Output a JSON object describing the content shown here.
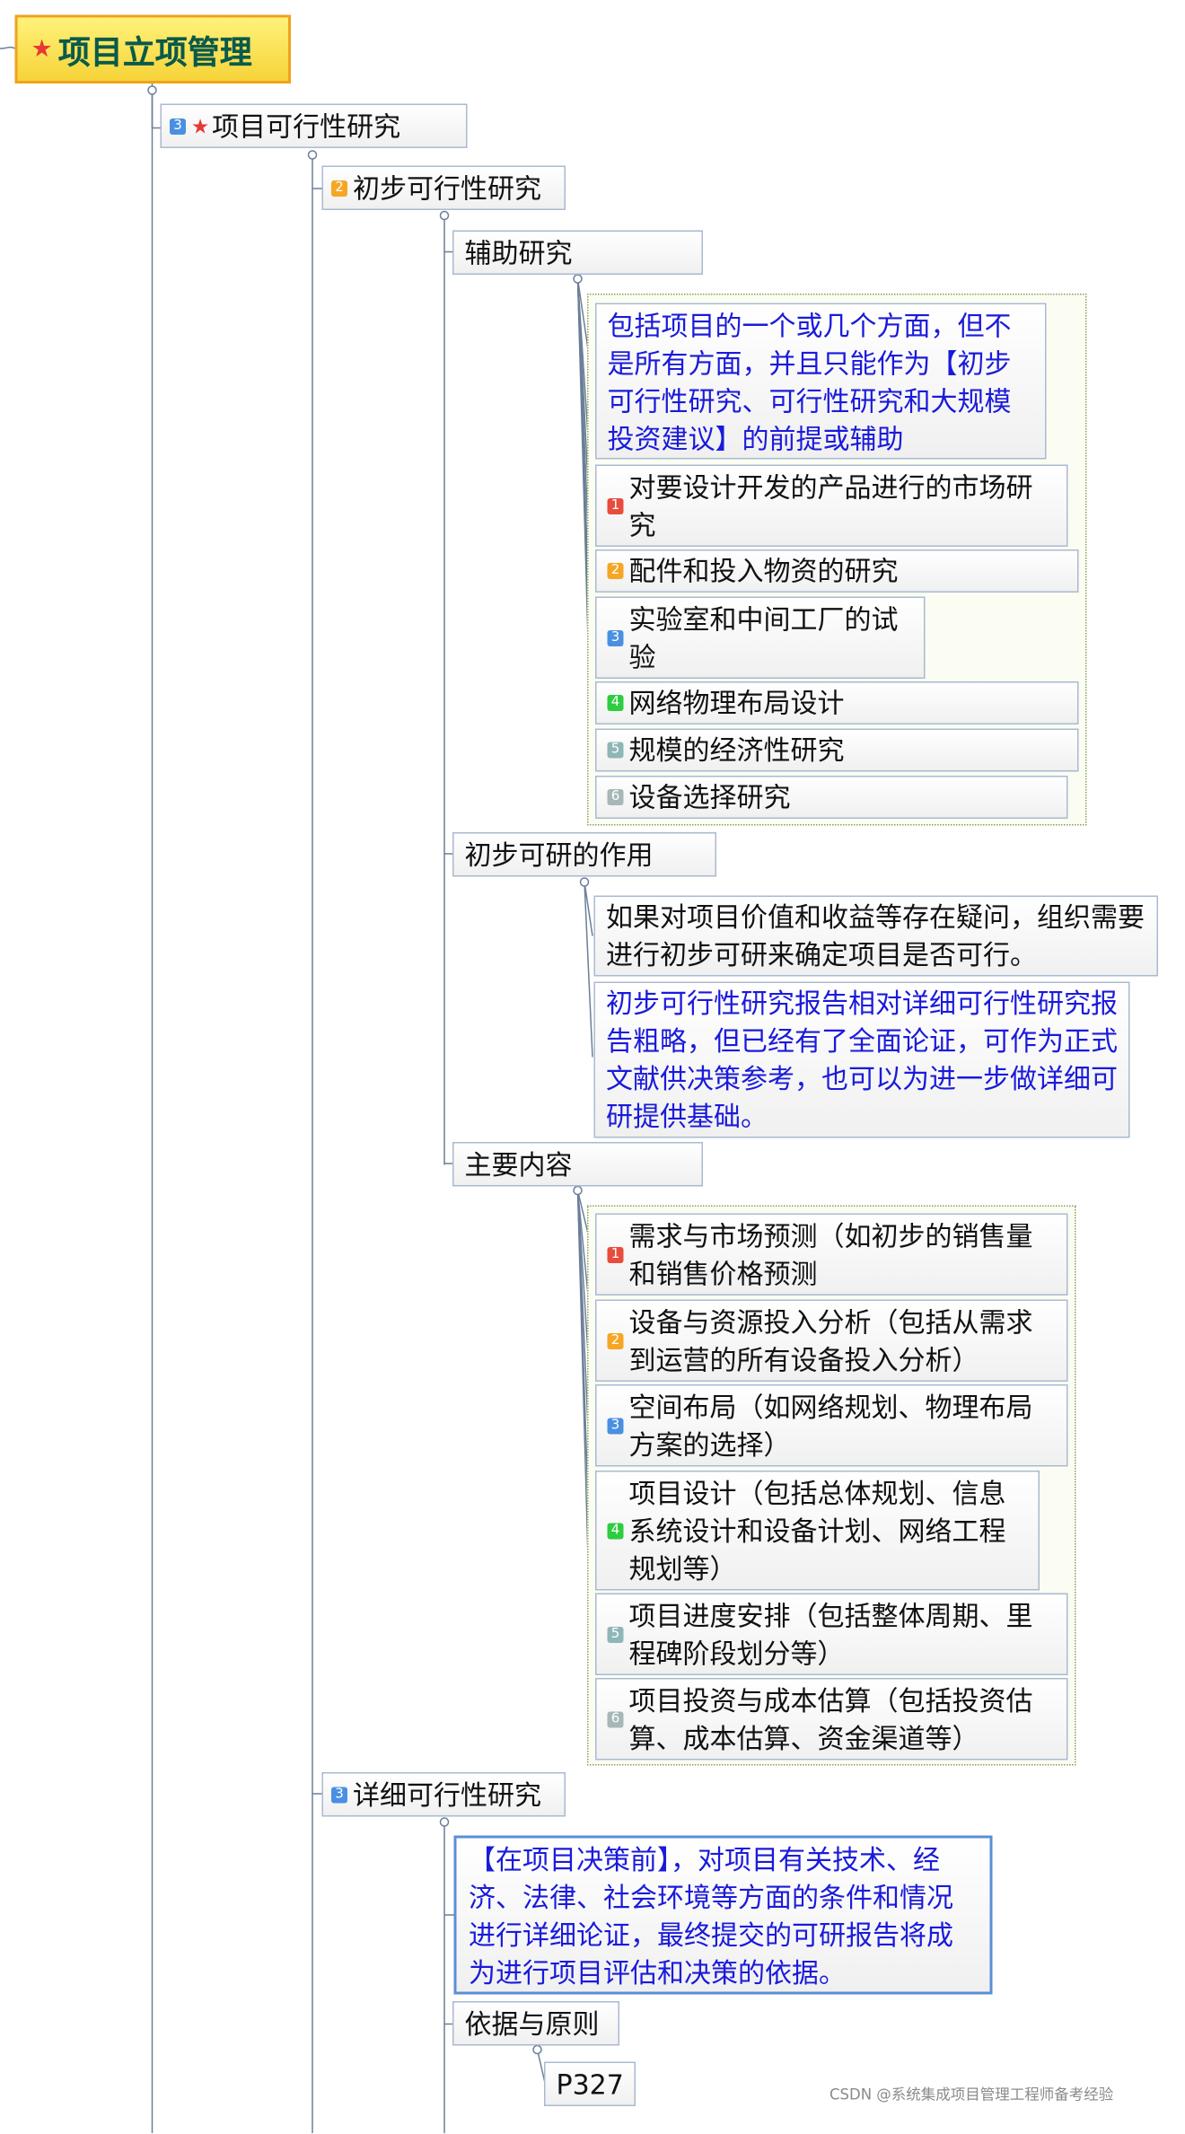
{
  "root": {
    "title": "项目立项管理"
  },
  "level1": {
    "badge": "3",
    "label": "项目可行性研究"
  },
  "prelim": {
    "badge": "2",
    "label": "初步可行性研究",
    "aux": {
      "label": "辅助研究",
      "note": "包括项目的一个或几个方面，但不是所有方面，并且只能作为【初步可行性研究、可行性研究和大规模投资建议】的前提或辅助",
      "items": [
        {
          "badge": "1",
          "text": "对要设计开发的产品进行的市场研究"
        },
        {
          "badge": "2",
          "text": "配件和投入物资的研究"
        },
        {
          "badge": "3",
          "text": "实验室和中间工厂的试验"
        },
        {
          "badge": "4",
          "text": "网络物理布局设计"
        },
        {
          "badge": "5",
          "text": "规模的经济性研究"
        },
        {
          "badge": "6",
          "text": "设备选择研究"
        }
      ]
    },
    "role": {
      "label": "初步可研的作用",
      "text1": "如果对项目价值和收益等存在疑问，组织需要进行初步可研来确定项目是否可行。",
      "text2": "初步可行性研究报告相对详细可行性研究报告粗略，但已经有了全面论证，可作为正式文献供决策参考，也可以为进一步做详细可研提供基础。"
    },
    "content": {
      "label": "主要内容",
      "items": [
        {
          "badge": "1",
          "text": "需求与市场预测（如初步的销售量和销售价格预测"
        },
        {
          "badge": "2",
          "text": "设备与资源投入分析（包括从需求到运营的所有设备投入分析）"
        },
        {
          "badge": "3",
          "text": "空间布局（如网络规划、物理布局方案的选择）"
        },
        {
          "badge": "4",
          "text": "项目设计（包括总体规划、信息系统设计和设备计划、网络工程规划等）"
        },
        {
          "badge": "5",
          "text": "项目进度安排（包括整体周期、里程碑阶段划分等）"
        },
        {
          "badge": "6",
          "text": "项目投资与成本估算（包括投资估算、成本估算、资金渠道等）"
        }
      ]
    }
  },
  "detail": {
    "badge": "3",
    "label": "详细可行性研究",
    "note": "【在项目决策前】，对项目有关技术、经济、法律、社会环境等方面的条件和情况进行详细论证，最终提交的可研报告将成为进行项目评估和决策的依据。",
    "basis": {
      "label": "依据与原则",
      "ref": "P327"
    }
  },
  "watermark": "CSDN @系统集成项目管理工程师备考经验"
}
